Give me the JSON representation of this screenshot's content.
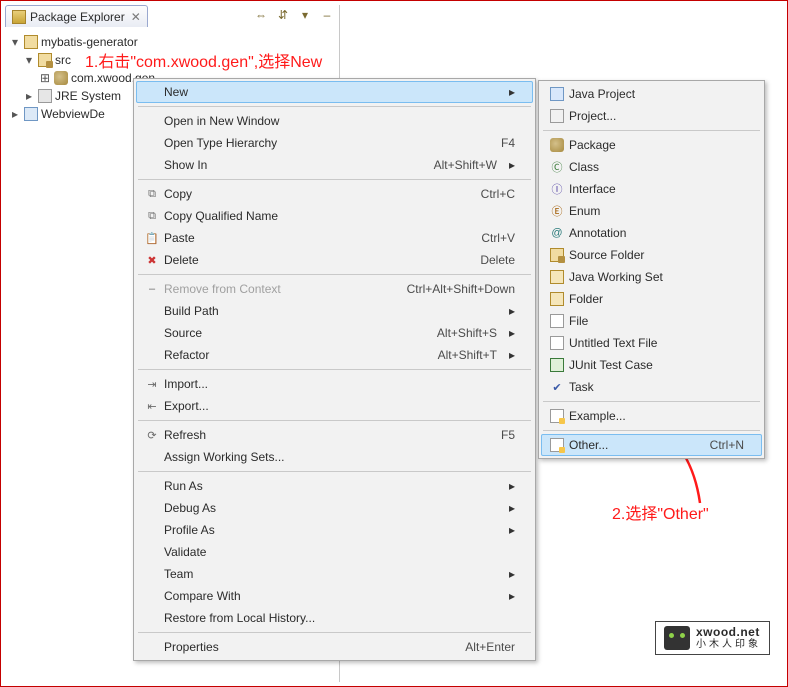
{
  "explorer": {
    "title": "Package Explorer",
    "tree": {
      "root": "mybatis-generator",
      "src": "src",
      "pkg": "com.xwood.gen",
      "jre": "JRE System",
      "web": "WebviewDe"
    }
  },
  "annotations": {
    "a1": "1.右击\"com.xwood.gen\",选择New",
    "a2": "2.选择\"Other\""
  },
  "ctx_main": [
    {
      "label": "New",
      "sub": true,
      "hover": true
    },
    {
      "sep": true
    },
    {
      "label": "Open in New Window"
    },
    {
      "label": "Open Type Hierarchy",
      "accel": "F4"
    },
    {
      "label": "Show In",
      "accel": "Alt+Shift+W",
      "sub": true
    },
    {
      "sep": true
    },
    {
      "label": "Copy",
      "accel": "Ctrl+C",
      "icon": "ic-copy"
    },
    {
      "label": "Copy Qualified Name",
      "icon": "ic-copy"
    },
    {
      "label": "Paste",
      "accel": "Ctrl+V",
      "icon": "ic-paste"
    },
    {
      "label": "Delete",
      "accel": "Delete",
      "icon": "ic-delete"
    },
    {
      "sep": true
    },
    {
      "label": "Remove from Context",
      "accel": "Ctrl+Alt+Shift+Down",
      "icon": "ic-remove",
      "disabled": true
    },
    {
      "label": "Build Path",
      "sub": true
    },
    {
      "label": "Source",
      "accel": "Alt+Shift+S",
      "sub": true
    },
    {
      "label": "Refactor",
      "accel": "Alt+Shift+T",
      "sub": true
    },
    {
      "sep": true
    },
    {
      "label": "Import...",
      "icon": "ic-import"
    },
    {
      "label": "Export...",
      "icon": "ic-export"
    },
    {
      "sep": true
    },
    {
      "label": "Refresh",
      "accel": "F5",
      "icon": "ic-refresh"
    },
    {
      "label": "Assign Working Sets..."
    },
    {
      "sep": true
    },
    {
      "label": "Run As",
      "sub": true
    },
    {
      "label": "Debug As",
      "sub": true
    },
    {
      "label": "Profile As",
      "sub": true
    },
    {
      "label": "Validate"
    },
    {
      "label": "Team",
      "sub": true
    },
    {
      "label": "Compare With",
      "sub": true
    },
    {
      "label": "Restore from Local History..."
    },
    {
      "sep": true
    },
    {
      "label": "Properties",
      "accel": "Alt+Enter"
    }
  ],
  "ctx_new": [
    {
      "label": "Java Project",
      "icon": "ic-javaprj"
    },
    {
      "label": "Project...",
      "icon": "ic-project"
    },
    {
      "sep": true
    },
    {
      "label": "Package",
      "icon": "ic-package"
    },
    {
      "label": "Class",
      "icon": "ic-class"
    },
    {
      "label": "Interface",
      "icon": "ic-interface"
    },
    {
      "label": "Enum",
      "icon": "ic-enum"
    },
    {
      "label": "Annotation",
      "icon": "ic-annot"
    },
    {
      "label": "Source Folder",
      "icon": "ic-srcfolder"
    },
    {
      "label": "Java Working Set",
      "icon": "ic-folder"
    },
    {
      "label": "Folder",
      "icon": "ic-folder"
    },
    {
      "label": "File",
      "icon": "ic-file"
    },
    {
      "label": "Untitled Text File",
      "icon": "ic-file"
    },
    {
      "label": "JUnit Test Case",
      "icon": "ic-junit"
    },
    {
      "label": "Task",
      "icon": "ic-task"
    },
    {
      "sep": true
    },
    {
      "label": "Example...",
      "icon": "ic-wizard"
    },
    {
      "sep": true
    },
    {
      "label": "Other...",
      "accel": "Ctrl+N",
      "icon": "ic-wizard",
      "hover": true
    }
  ],
  "watermark": {
    "line1": "xwood.net",
    "line2": "小木人印象"
  }
}
